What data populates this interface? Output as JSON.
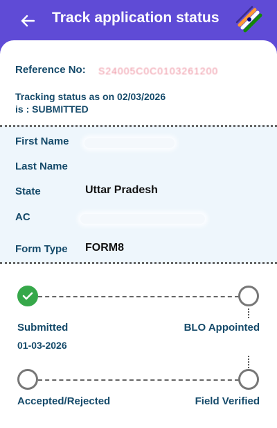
{
  "header": {
    "title": "Track application status",
    "back_icon": "arrow-left-icon",
    "logo": "eci-logo",
    "background_color": "#5f4bd6"
  },
  "reference": {
    "label": "Reference No:",
    "value": "S24005C0C0103261200"
  },
  "tracking": {
    "line1": "Tracking status as on 02/03/2026",
    "line2": "is : SUBMITTED"
  },
  "details": [
    {
      "label": "First Name",
      "value": ""
    },
    {
      "label": "Last Name",
      "value": ""
    },
    {
      "label": "State",
      "value": "Uttar Pradesh"
    },
    {
      "label": "AC",
      "value": ""
    },
    {
      "label": "Form Type",
      "value": "FORM8"
    }
  ],
  "timeline": {
    "steps": [
      {
        "label": "Submitted",
        "date": "01-03-2026",
        "status": "done"
      },
      {
        "label": "BLO Appointed",
        "status": "pending"
      },
      {
        "label": "Accepted/Rejected",
        "status": "pending"
      },
      {
        "label": "Field Verified",
        "status": "pending"
      }
    ],
    "done_color": "#36a84a"
  }
}
